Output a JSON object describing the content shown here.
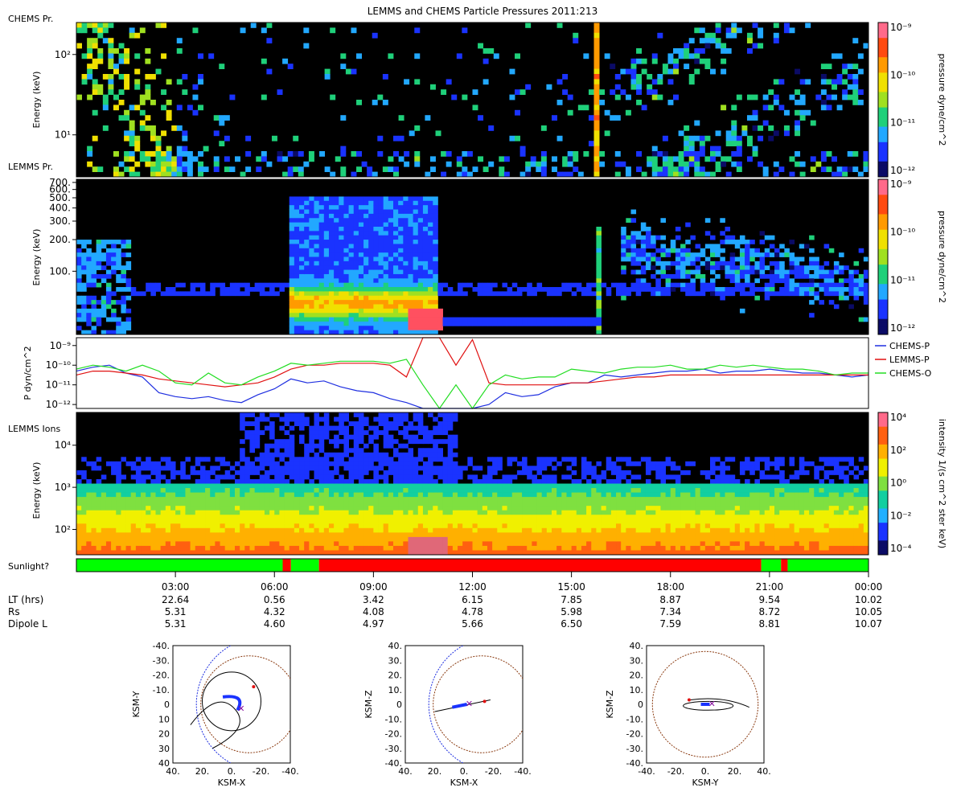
{
  "page": {
    "title": "LEMMS and CHEMS Particle Pressures  2011:213"
  },
  "colors": {
    "chems_p": "#1f2fe0",
    "lemms_p": "#e01010",
    "chems_o": "#22dd22",
    "sunlit": "#00ff00",
    "shadow": "#ff0000",
    "pressure_colormap": [
      "#0b0b66",
      "#1a33ff",
      "#22a8ff",
      "#1fd07a",
      "#a0e020",
      "#f0e000",
      "#ff9a00",
      "#ff4a10",
      "#ff6a8a"
    ],
    "intensity_colormap": [
      "#0b0b66",
      "#1a33ff",
      "#22b0ff",
      "#12cfa0",
      "#7fe040",
      "#f0f000",
      "#ffb000",
      "#ff6010",
      "#ff6a8a"
    ]
  },
  "chart_data": [
    {
      "type": "heatmap",
      "panel": "CHEMS Pr.",
      "ylabel": "Energy (keV)",
      "yscale": "log",
      "ylim": [
        3,
        250
      ],
      "yticks": [
        {
          "value": 10,
          "label": "10¹"
        },
        {
          "value": 100,
          "label": "10²"
        }
      ],
      "colorbar": {
        "label": "pressure dyne/cm^2",
        "scale": "log",
        "ticks": [
          {
            "value": -9,
            "label": "10⁻⁹"
          },
          {
            "value": -10,
            "label": "10⁻¹⁰"
          },
          {
            "value": -11,
            "label": "10⁻¹¹"
          },
          {
            "value": -12,
            "label": "10⁻¹²"
          }
        ]
      }
    },
    {
      "type": "heatmap",
      "panel": "LEMMS Pr.",
      "ylabel": "Energy (keV)",
      "yscale": "log",
      "ylim": [
        25,
        750
      ],
      "yticks": [
        {
          "value": 100,
          "label": "100."
        },
        {
          "value": 200,
          "label": "200."
        },
        {
          "value": 300,
          "label": "300."
        },
        {
          "value": 400,
          "label": "400."
        },
        {
          "value": 500,
          "label": "500."
        },
        {
          "value": 600,
          "label": "600."
        },
        {
          "value": 700,
          "label": "700."
        }
      ],
      "colorbar": {
        "label": "pressure dyne/cm^2",
        "scale": "log",
        "ticks": [
          {
            "value": -9,
            "label": "10⁻⁹"
          },
          {
            "value": -10,
            "label": "10⁻¹⁰"
          },
          {
            "value": -11,
            "label": "10⁻¹¹"
          },
          {
            "value": -12,
            "label": "10⁻¹²"
          }
        ]
      }
    },
    {
      "type": "line",
      "ylabel": "P dyn/cm^2",
      "yscale": "log",
      "ylim": [
        -12.2,
        -8.6
      ],
      "yticks": [
        {
          "value": -9,
          "label": "10⁻⁹"
        },
        {
          "value": -10,
          "label": "10⁻¹⁰"
        },
        {
          "value": -11,
          "label": "10⁻¹¹"
        },
        {
          "value": -12,
          "label": "10⁻¹²"
        }
      ],
      "legend_position": "right",
      "x_hours": [
        0,
        0.5,
        1,
        1.5,
        2,
        2.5,
        3,
        3.5,
        4,
        4.5,
        5,
        5.5,
        6,
        6.5,
        7,
        7.5,
        8,
        8.5,
        9,
        9.5,
        10,
        10.5,
        11,
        11.5,
        12,
        12.5,
        13,
        13.5,
        14,
        14.5,
        15,
        15.5,
        16,
        16.5,
        17,
        17.5,
        18,
        18.5,
        19,
        19.5,
        20,
        20.5,
        21,
        21.5,
        22,
        22.5,
        23,
        23.5,
        24
      ],
      "series": [
        {
          "name": "CHEMS-P",
          "log10_values": [
            -10.3,
            -10.1,
            -10.0,
            -10.4,
            -10.6,
            -11.4,
            -11.6,
            -11.7,
            -11.6,
            -11.8,
            -11.9,
            -11.5,
            -11.2,
            -10.7,
            -10.9,
            -10.8,
            -11.1,
            -11.3,
            -11.4,
            -11.7,
            -11.9,
            -12.2,
            -12.2,
            -12.2,
            -12.2,
            -12.0,
            -11.4,
            -11.6,
            -11.5,
            -11.1,
            -10.9,
            -10.9,
            -10.5,
            -10.6,
            -10.5,
            -10.4,
            -10.3,
            -10.3,
            -10.2,
            -10.4,
            -10.3,
            -10.3,
            -10.2,
            -10.3,
            -10.4,
            -10.4,
            -10.5,
            -10.6,
            -10.5
          ]
        },
        {
          "name": "LEMMS-P",
          "log10_values": [
            -10.5,
            -10.3,
            -10.3,
            -10.4,
            -10.5,
            -10.7,
            -10.8,
            -10.9,
            -11.0,
            -11.1,
            -11.0,
            -10.9,
            -10.6,
            -10.2,
            -10.0,
            -10.0,
            -9.9,
            -9.9,
            -9.9,
            -10.0,
            -10.6,
            -8.6,
            -8.6,
            -10.0,
            -8.7,
            -10.9,
            -11.0,
            -11.0,
            -11.0,
            -11.0,
            -10.9,
            -10.9,
            -10.8,
            -10.7,
            -10.6,
            -10.6,
            -10.5,
            -10.5,
            -10.5,
            -10.5,
            -10.5,
            -10.5,
            -10.5,
            -10.5,
            -10.5,
            -10.5,
            -10.5,
            -10.5,
            -10.5
          ]
        },
        {
          "name": "CHEMS-O",
          "log10_values": [
            -10.2,
            -10.0,
            -10.1,
            -10.3,
            -10.0,
            -10.3,
            -10.9,
            -11.0,
            -10.4,
            -10.9,
            -11.0,
            -10.6,
            -10.3,
            -9.9,
            -10.0,
            -9.9,
            -9.8,
            -9.8,
            -9.8,
            -9.9,
            -9.7,
            -11.0,
            -12.2,
            -11.0,
            -12.2,
            -11.0,
            -10.5,
            -10.7,
            -10.6,
            -10.6,
            -10.2,
            -10.3,
            -10.4,
            -10.2,
            -10.1,
            -10.1,
            -10.0,
            -10.2,
            -10.2,
            -10.0,
            -10.1,
            -10.0,
            -10.1,
            -10.2,
            -10.2,
            -10.3,
            -10.5,
            -10.4,
            -10.4
          ]
        }
      ]
    },
    {
      "type": "heatmap",
      "panel": "LEMMS Ions",
      "ylabel": "Energy (keV)",
      "yscale": "log",
      "ylim": [
        25,
        60000
      ],
      "yticks": [
        {
          "value": 100,
          "label": "10²"
        },
        {
          "value": 1000,
          "label": "10³"
        },
        {
          "value": 10000,
          "label": "10⁴"
        }
      ],
      "colorbar": {
        "label": "intensity 1/(s cm^2 ster keV)",
        "scale": "log",
        "ticks": [
          {
            "value": 4,
            "label": "10⁴"
          },
          {
            "value": 2,
            "label": "10²"
          },
          {
            "value": 0,
            "label": "10⁰"
          },
          {
            "value": -2,
            "label": "10⁻²"
          },
          {
            "value": -4,
            "label": "10⁻⁴"
          }
        ]
      }
    }
  ],
  "sunlight": {
    "label": "Sunlight?",
    "segments": [
      {
        "start": 0.0,
        "end": 6.25,
        "state": "sunlit"
      },
      {
        "start": 6.25,
        "end": 6.5,
        "state": "shadow"
      },
      {
        "start": 6.5,
        "end": 7.35,
        "state": "sunlit"
      },
      {
        "start": 7.35,
        "end": 20.75,
        "state": "shadow"
      },
      {
        "start": 20.75,
        "end": 21.35,
        "state": "sunlit"
      },
      {
        "start": 21.35,
        "end": 21.55,
        "state": "shadow"
      },
      {
        "start": 21.55,
        "end": 24.0,
        "state": "sunlit"
      }
    ]
  },
  "time_axis": {
    "ticks": [
      {
        "hour": 3,
        "label": "03:00"
      },
      {
        "hour": 6,
        "label": "06:00"
      },
      {
        "hour": 9,
        "label": "09:00"
      },
      {
        "hour": 12,
        "label": "12:00"
      },
      {
        "hour": 15,
        "label": "15:00"
      },
      {
        "hour": 18,
        "label": "18:00"
      },
      {
        "hour": 21,
        "label": "21:00"
      },
      {
        "hour": 24,
        "label": "00:00"
      }
    ],
    "rows": [
      {
        "label": "LT (hrs)",
        "values": [
          "22.64",
          "0.56",
          "3.42",
          "6.15",
          "7.85",
          "8.87",
          "9.54",
          "10.02"
        ]
      },
      {
        "label": "Rs",
        "values": [
          "5.31",
          "4.32",
          "4.08",
          "4.78",
          "5.98",
          "7.34",
          "8.72",
          "10.05"
        ]
      },
      {
        "label": "Dipole L",
        "values": [
          "5.31",
          "4.60",
          "4.97",
          "5.66",
          "6.50",
          "7.59",
          "8.81",
          "10.07"
        ]
      }
    ]
  },
  "orbit_plots": [
    {
      "xlabel": "KSM-X",
      "ylabel": "KSM-Y",
      "xticks": [
        "40.",
        "20.",
        "0.",
        "-20.",
        "-40."
      ],
      "yticks": [
        "-40.",
        "-30.",
        "-20.",
        "-10.",
        "0",
        "10",
        "20",
        "30",
        "40"
      ]
    },
    {
      "xlabel": "KSM-X",
      "ylabel": "KSM-Z",
      "xticks": [
        "40.",
        "20.",
        "0.",
        "-20.",
        "-40."
      ],
      "yticks": [
        "40.",
        "30.",
        "20.",
        "10.",
        "0",
        "-10.",
        "-20.",
        "-30.",
        "-40."
      ]
    },
    {
      "xlabel": "KSM-Y",
      "ylabel": "KSM-Z",
      "xticks": [
        "-40.",
        "-20.",
        "0.",
        "20.",
        "40."
      ],
      "yticks": [
        "40.",
        "30.",
        "20.",
        "10.",
        "0",
        "-10.",
        "-20.",
        "-30.",
        "-40."
      ]
    }
  ]
}
